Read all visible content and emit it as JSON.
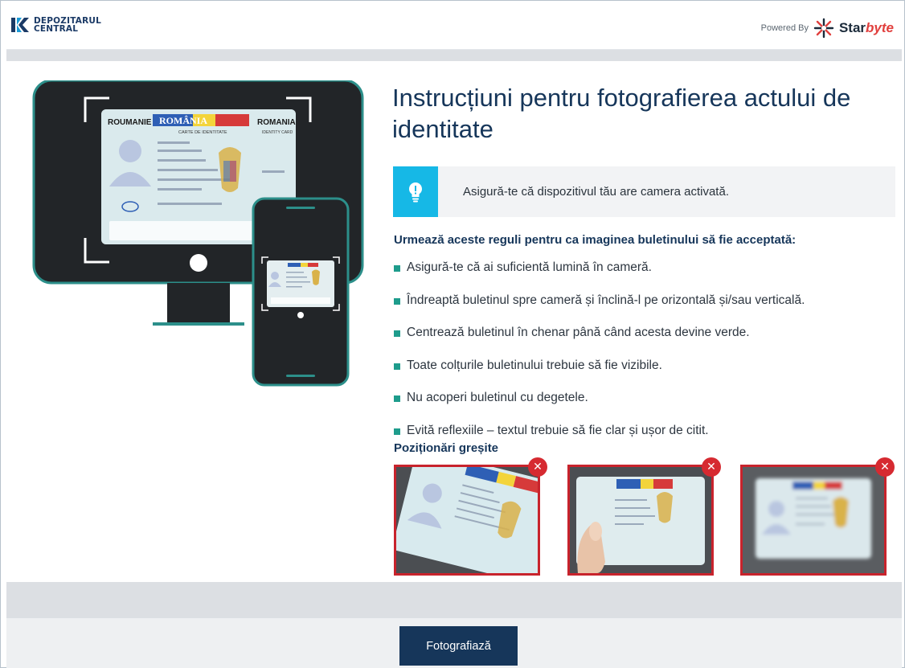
{
  "header": {
    "logo_line1": "DEPOZITARUL",
    "logo_line2": "CENTRAL",
    "powered_by": "Powered By",
    "brand_part1": "Star",
    "brand_part2": "byte"
  },
  "main": {
    "title": "Instrucțiuni pentru fotografierea actului de identitate",
    "hint": "Asigură-te că dispozitivul tău are camera activată.",
    "rules_heading": "Urmează aceste reguli pentru ca imaginea buletinului să fie acceptată:",
    "rules": [
      "Asigură-te că ai suficientă lumină în cameră.",
      "Îndreaptă buletinul spre cameră și înclină-l pe orizontală și/sau verticală.",
      "Centrează buletinul în chenar până când acesta devine verde.",
      "Toate colțurile buletinului trebuie să fie vizibile.",
      "Nu acoperi buletinul cu degetele.",
      "Evită reflexiile – textul trebuie să fie clar și ușor de citit."
    ],
    "wrong_heading": "Poziționări greșite"
  },
  "id_card": {
    "left_label": "ROUMANIE",
    "center_label": "ROMÂNIA",
    "right_label": "ROMANIA",
    "subtitle": "CARTE DE IDENTITATE",
    "identity_card": "IDENTITY CARD"
  },
  "footer": {
    "button_label": "Fotografiază"
  },
  "colors": {
    "navy": "#16365a",
    "teal": "#2c8f8a",
    "cyan": "#16b8e6",
    "error_red": "#d62a31"
  }
}
